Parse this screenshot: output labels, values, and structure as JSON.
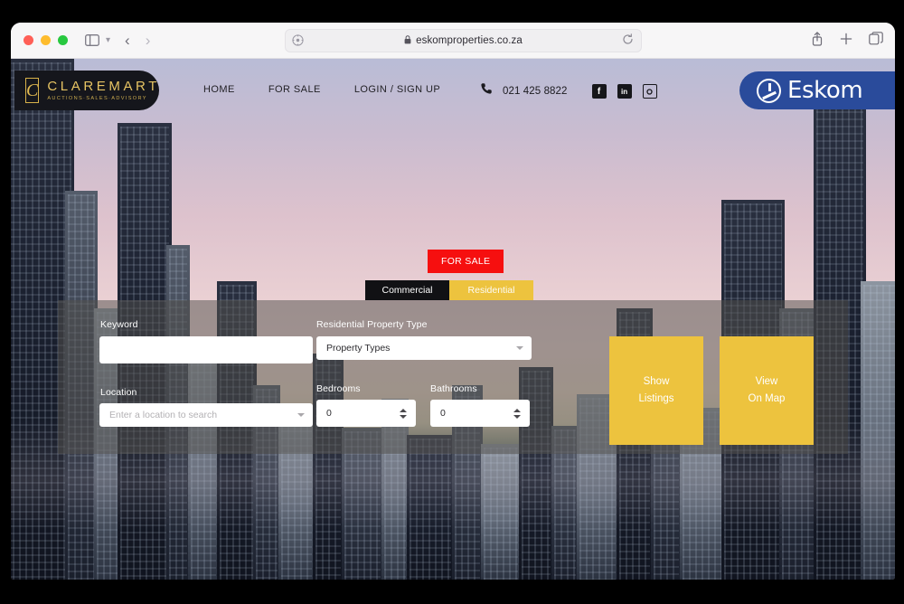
{
  "browser": {
    "url": "eskomproperties.co.za",
    "lock_icon": "lock-icon",
    "reload_icon": "reload-icon",
    "shield_icon": "privacy-shield-icon",
    "share_icon": "share-icon",
    "newtab_icon": "plus-icon",
    "tabs_icon": "tab-overview-icon",
    "back_icon": "chevron-left-icon",
    "forward_icon": "chevron-right-icon",
    "sidebar_icon": "sidebar-icon",
    "sidebar_chevron": "chevron-down-icon"
  },
  "site": {
    "logo": {
      "mark": "C",
      "name": "CLAREMART",
      "tagline": "AUCTIONS·SALES·ADVISORY"
    },
    "nav": [
      {
        "label": "HOME"
      },
      {
        "label": "FOR SALE"
      },
      {
        "label": "LOGIN / SIGN UP"
      }
    ],
    "contact": {
      "phone_icon": "phone-icon",
      "phone": "021 425 8822",
      "socials": [
        {
          "name": "facebook-icon",
          "glyph": "f"
        },
        {
          "name": "linkedin-icon",
          "glyph": "in"
        },
        {
          "name": "instagram-icon",
          "glyph": "◎"
        }
      ]
    },
    "partner": {
      "name": "Eskom",
      "mark": "eskom-logo-icon",
      "color": "#2a4b9b"
    }
  },
  "hero": {
    "badge": "FOR SALE",
    "tabs": [
      {
        "label": "Commercial",
        "active": false,
        "color": "#111114"
      },
      {
        "label": "Residential",
        "active": true,
        "color": "#edc33e"
      }
    ]
  },
  "search": {
    "keyword": {
      "label": "Keyword",
      "value": "",
      "placeholder": ""
    },
    "location": {
      "label": "Location",
      "value": "",
      "placeholder": "Enter a location to search"
    },
    "property_type": {
      "label": "Residential Property Type",
      "value": "Property Types"
    },
    "bedrooms": {
      "label": "Bedrooms",
      "value": "0"
    },
    "bathrooms": {
      "label": "Bathrooms",
      "value": "0"
    },
    "show_listings": {
      "line1": "Show",
      "line2": "Listings"
    },
    "view_on_map": {
      "line1": "View",
      "line2": "On Map"
    }
  },
  "colors": {
    "accent_yellow": "#edc33e",
    "badge_red": "#f60f0f",
    "brand_blue": "#2a4b9b",
    "logo_gold": "#e7c463"
  }
}
